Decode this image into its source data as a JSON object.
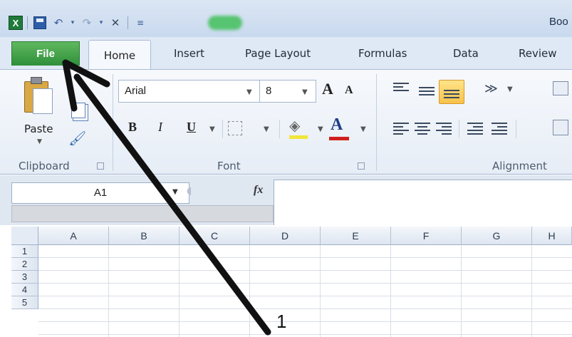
{
  "title": "Boo",
  "ribbon_tabs": {
    "file": "File",
    "home": "Home",
    "insert": "Insert",
    "page_layout": "Page Layout",
    "formulas": "Formulas",
    "data": "Data",
    "review": "Review"
  },
  "clipboard": {
    "paste_label": "Paste",
    "group_label": "Clipboard"
  },
  "font": {
    "family": "Arial",
    "size": "8",
    "bold": "B",
    "italic": "I",
    "underline": "U",
    "font_color_glyph": "A",
    "grow_glyph": "A",
    "shrink_glyph": "A",
    "group_label": "Font"
  },
  "alignment": {
    "group_label": "Alignment"
  },
  "formula_bar": {
    "name_box": "A1",
    "fx_label": "fx",
    "value": ""
  },
  "grid": {
    "columns": [
      "A",
      "B",
      "C",
      "D",
      "E",
      "F",
      "G",
      "H"
    ],
    "rows": [
      "1",
      "2",
      "3",
      "4",
      "5"
    ]
  },
  "annotation": {
    "label": "1"
  },
  "colors": {
    "file_tab": "#2f8f3a",
    "ribbon_bg": "#e6edf6",
    "highlight_fill": "#f2e63a",
    "font_color": "#d0201e",
    "arrow": "#111111"
  }
}
